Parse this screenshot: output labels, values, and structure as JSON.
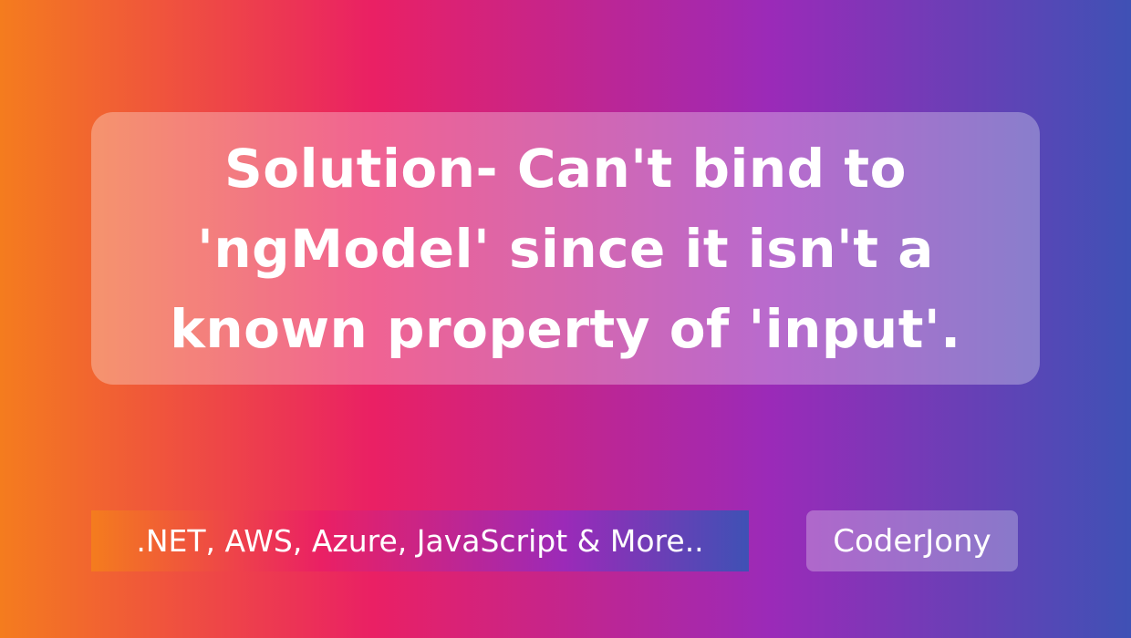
{
  "title": {
    "lines": [
      "Solution- Can't bind to",
      "'ngModel' since it isn't a",
      "known property of 'input'."
    ]
  },
  "footer": {
    "topics": ".NET, AWS, Azure, JavaScript & More..",
    "brand": "CoderJony"
  },
  "colors": {
    "gradient": [
      "#f47c1e",
      "#ea2064",
      "#9b2ab8",
      "#3f51b5"
    ],
    "text": "#ffffff"
  }
}
